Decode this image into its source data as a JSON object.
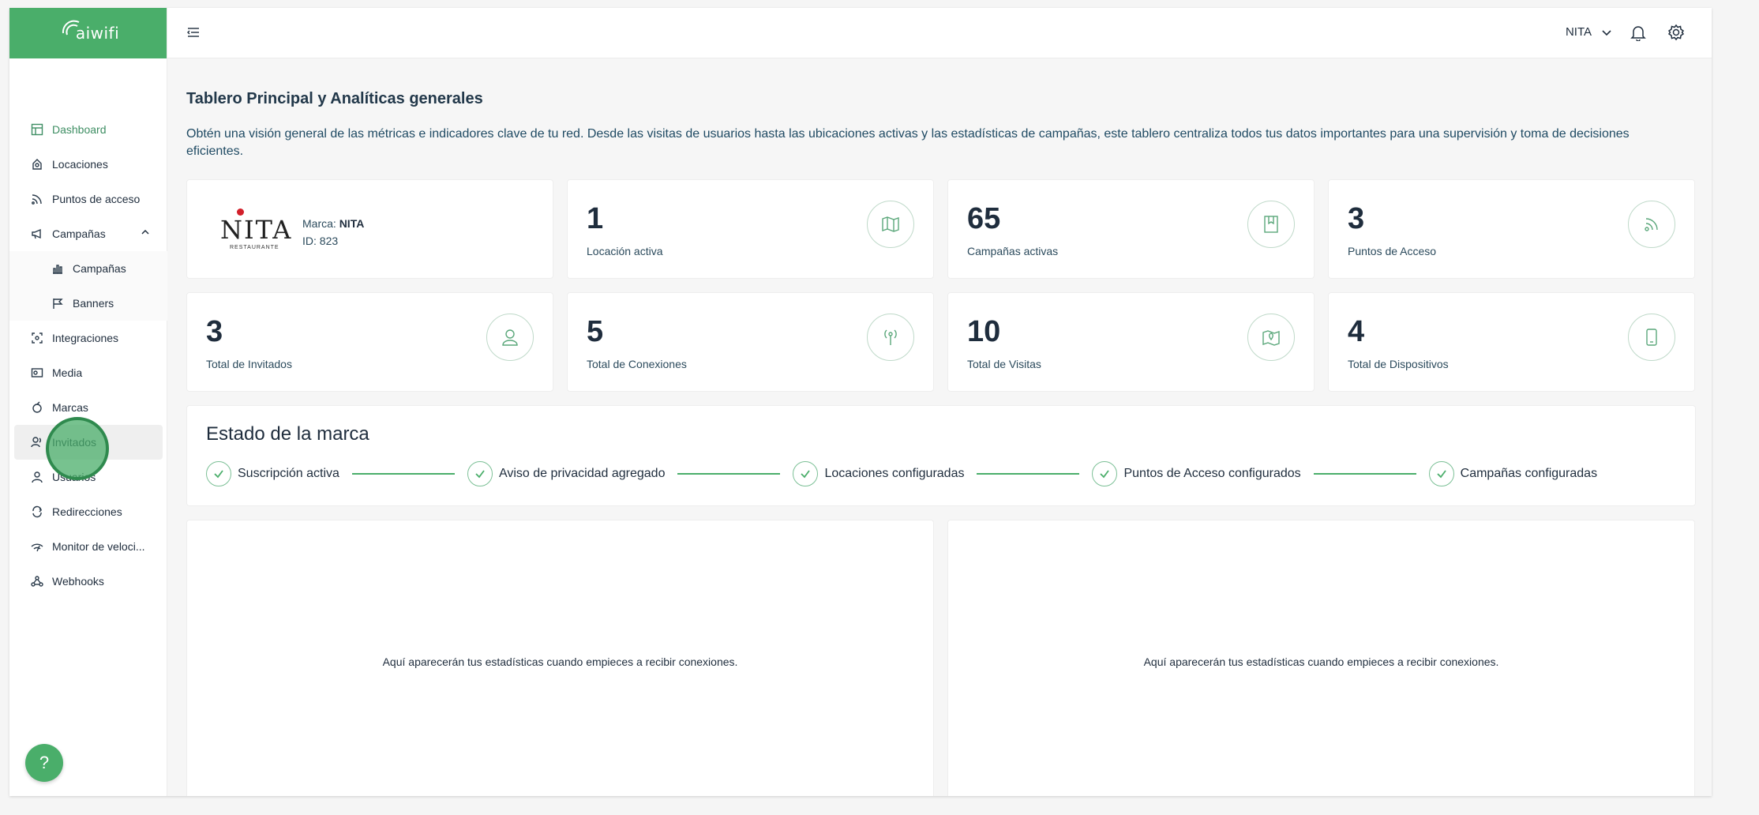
{
  "app": {
    "logo_text": "aiwifi",
    "brand_color": "#4aae6a"
  },
  "sidebar": {
    "items": [
      {
        "label": "Dashboard",
        "icon": "dashboard-icon"
      },
      {
        "label": "Locaciones",
        "icon": "location-icon"
      },
      {
        "label": "Puntos de acceso",
        "icon": "access-point-icon"
      },
      {
        "label": "Campañas",
        "icon": "megaphone-icon",
        "expanded": true
      },
      {
        "label": "Integraciones",
        "icon": "integrations-icon"
      },
      {
        "label": "Media",
        "icon": "media-icon"
      },
      {
        "label": "Marcas",
        "icon": "brands-icon"
      },
      {
        "label": "Invitados",
        "icon": "guests-icon"
      },
      {
        "label": "Usuarios",
        "icon": "user-icon"
      },
      {
        "label": "Redirecciones",
        "icon": "redirect-icon"
      },
      {
        "label": "Monitor de veloci...",
        "icon": "speed-icon"
      },
      {
        "label": "Webhooks",
        "icon": "webhook-icon"
      }
    ],
    "sub_items": [
      {
        "label": "Campañas",
        "icon": "chart-icon"
      },
      {
        "label": "Banners",
        "icon": "flag-icon"
      }
    ],
    "help_label": "?"
  },
  "topbar": {
    "user": "NITA"
  },
  "main": {
    "title": "Tablero Principal y Analíticas generales",
    "description": "Obtén una visión general de las métricas e indicadores clave de tu red. Desde las visitas de usuarios hasta las ubicaciones activas y las estadísticas de campañas, este tablero centraliza todos tus datos importantes para una supervisión y toma de decisiones eficientes.",
    "brand": {
      "logo_name": "NITA",
      "logo_sub": "RESTAURANTE",
      "marca_label": "Marca:",
      "marca_value": "NITA",
      "id_text": "ID: 823"
    },
    "stats": [
      {
        "value": "1",
        "label": "Locación activa",
        "icon": "map-icon"
      },
      {
        "value": "65",
        "label": "Campañas activas",
        "icon": "bookmark-icon"
      },
      {
        "value": "3",
        "label": "Puntos de Acceso",
        "icon": "wifi-signal-icon"
      },
      {
        "value": "3",
        "label": "Total de Invitados",
        "icon": "guest-icon"
      },
      {
        "value": "5",
        "label": "Total de Conexiones",
        "icon": "antenna-icon"
      },
      {
        "value": "10",
        "label": "Total de Visitas",
        "icon": "map-pin-icon"
      },
      {
        "value": "4",
        "label": "Total de Dispositivos",
        "icon": "phone-icon"
      }
    ],
    "status": {
      "title": "Estado de la marca",
      "steps": [
        "Suscripción activa",
        "Aviso de privacidad agregado",
        "Locaciones configuradas",
        "Puntos de Acceso configurados",
        "Campañas configuradas"
      ]
    },
    "charts": {
      "empty_left": "Aquí aparecerán tus estadísticas cuando empieces a recibir conexiones.",
      "empty_right": "Aquí aparecerán tus estadísticas cuando empieces a recibir conexiones."
    }
  }
}
